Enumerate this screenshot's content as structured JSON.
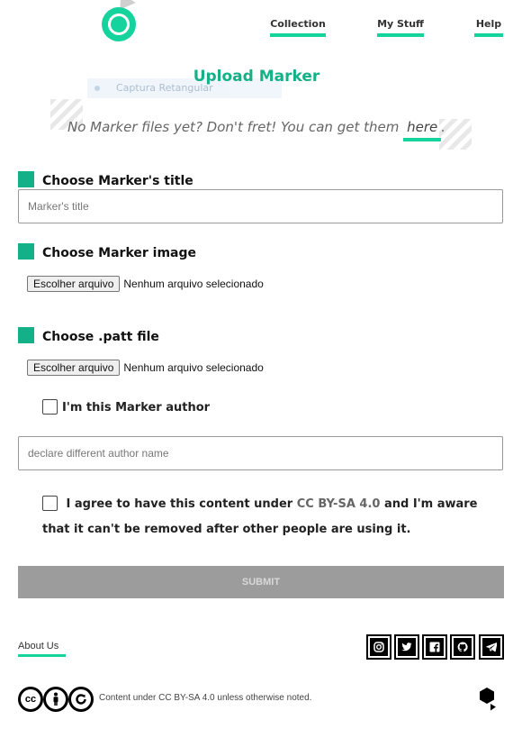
{
  "nav": {
    "collection": "Collection",
    "my_stuff": "My Stuff",
    "help": "Help"
  },
  "page_title": "Upload Marker",
  "ghost_tooltip": "Captura Retangular",
  "hint": {
    "text": "No Marker files yet? Don't fret! You can get them",
    "link": "here",
    "suffix": "."
  },
  "form": {
    "title_label": "Choose Marker's title",
    "title_placeholder": "Marker's title",
    "image_label": "Choose Marker image",
    "patt_label": "Choose .patt file",
    "file_button": "Escolher arquivo",
    "file_status": "Nenhum arquivo selecionado",
    "author_check": "I'm this Marker author",
    "author_placeholder": "declare different author name",
    "agree_prefix": "I agree to have this content under",
    "agree_license": "CC BY-SA 4.0",
    "agree_suffix": "and I'm aware that it can't be removed after other people are using it.",
    "submit": "SUBMIT"
  },
  "footer": {
    "about": "About Us",
    "license_text": "Content under CC BY-SA 4.0 unless otherwise noted.",
    "cc_badge": "cc",
    "social": [
      "instagram-icon",
      "twitter-icon",
      "facebook-icon",
      "github-icon",
      "telegram-icon"
    ]
  },
  "colors": {
    "accent": "#14d39c",
    "accent_dark": "#14b088",
    "submit_disabled": "#9c9c9c"
  }
}
